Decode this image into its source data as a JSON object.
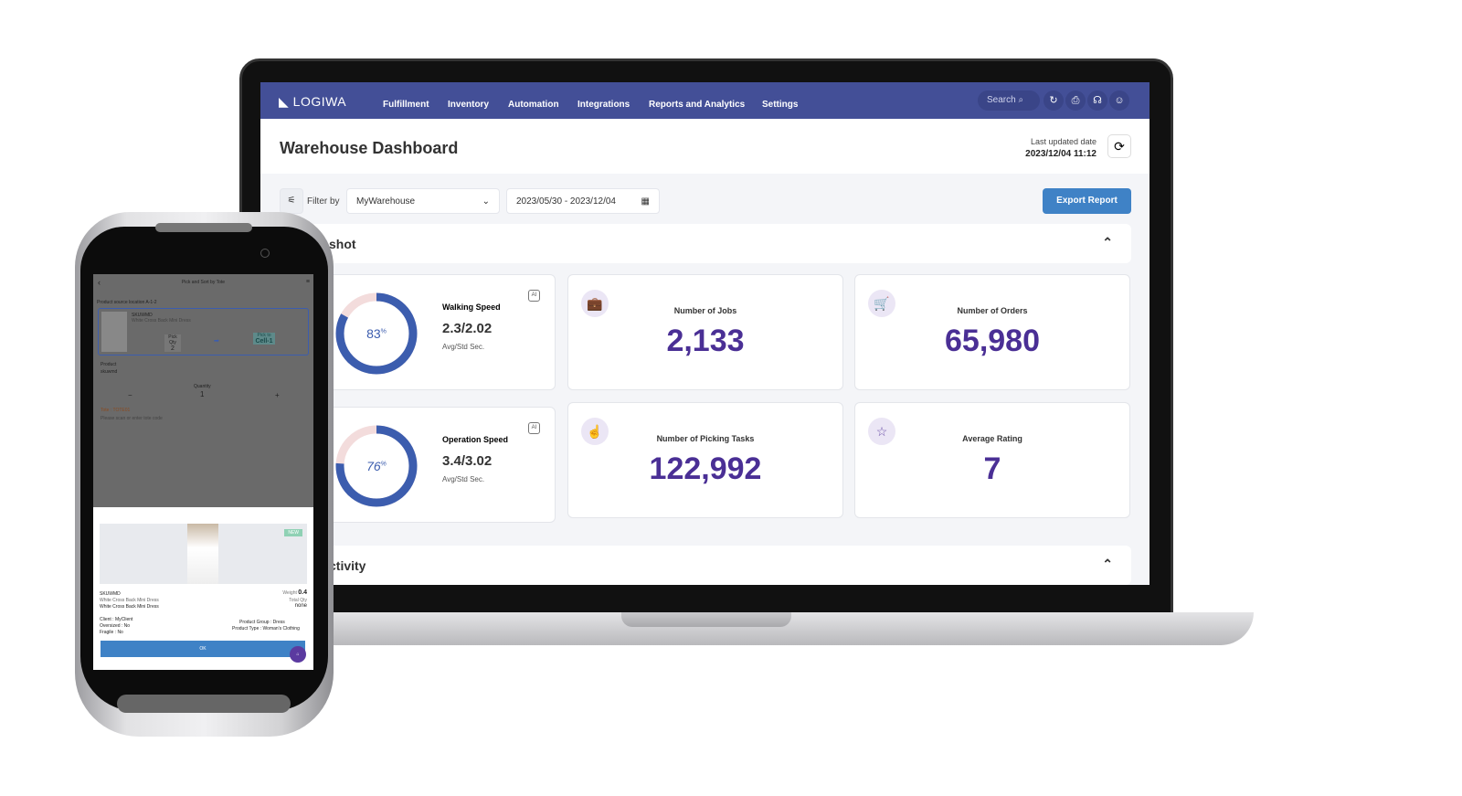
{
  "nav": {
    "brand": "LOGIWA",
    "items": [
      "Fulfillment",
      "Inventory",
      "Automation",
      "Integrations",
      "Reports and Analytics",
      "Settings"
    ],
    "search_placeholder": "Search",
    "icons": [
      "search-icon",
      "sync-icon",
      "print-icon",
      "headset-icon",
      "user-icon"
    ]
  },
  "header": {
    "title": "Warehouse Dashboard",
    "updated_label": "Last updated date",
    "updated_value": "2023/12/04 11:12"
  },
  "filter": {
    "label": "Filter by",
    "warehouse": "MyWarehouse",
    "date_range": "2023/05/30 - 2023/12/04",
    "export": "Export Report"
  },
  "snapshot": {
    "title": "shot",
    "speeds": [
      {
        "label": "Walking Speed",
        "value": "2.3/2.02",
        "unit": "Avg/Std Sec.",
        "percent": 83,
        "pct_label": "83",
        "badge": "AI"
      },
      {
        "label": "Operation Speed",
        "value": "3.4/3.02",
        "unit": "Avg/Std Sec.",
        "percent": 76,
        "pct_label": "76",
        "badge": "AI"
      }
    ],
    "cards": [
      {
        "label": "Number of Jobs",
        "value": "2,133",
        "icon": "briefcase-icon"
      },
      {
        "label": "Number of Orders",
        "value": "65,980",
        "icon": "cart-icon"
      },
      {
        "label": "Number of Picking Tasks",
        "value": "122,992",
        "icon": "hand-pointer-icon"
      },
      {
        "label": "Average Rating",
        "value": "7",
        "icon": "star-icon"
      }
    ]
  },
  "activity": {
    "title": "ctivity"
  },
  "colors": {
    "nav": "#434f97",
    "accent_blue": "#3f82c6",
    "value_purple": "#4a2f95",
    "donut": "#3c5dae",
    "donut_rest": "#f3dcdc"
  },
  "phone": {
    "title": "Pick and Sort by Tote",
    "source": "Product source location A-1-2",
    "sku": "SKUWMD",
    "desc": "White Cross Back Mini Dress",
    "pick_qty_label": "Pick Qty",
    "pick_qty": "2",
    "pick_to_label": "Pick to",
    "pick_to": "Cell-1",
    "product_label": "Product",
    "product_value": "skuwmd",
    "quantity_label": "Quantity",
    "quantity": "1",
    "minus": "−",
    "plus": "+",
    "tote_label": "Tote : TOTE01",
    "tote_placeholder": "Please scan or enter tote code",
    "sheet": {
      "badge": "NEW",
      "sku": "SKUWMD",
      "desc": "White Cross Back Mini Dress",
      "desc2": "White Cross Back Mini Dress",
      "weight_label": "Weight",
      "weight": "0.4",
      "total_label": "Total Qty",
      "total": "none",
      "client": "Client : MyClient",
      "oversized": "Oversized : No",
      "fragile": "Fragile : No",
      "group": "Product Group : Dress",
      "type": "Product Type : Woman's Clothing",
      "ok": "OK"
    }
  }
}
